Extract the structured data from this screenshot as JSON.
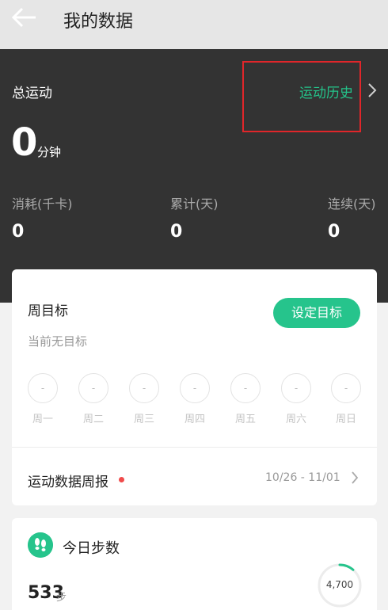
{
  "header": {
    "title": "我的数据"
  },
  "summary": {
    "total_label": "总运动",
    "history_link": "运动历史",
    "total_value": "0",
    "total_unit": "分钟",
    "stats": [
      {
        "label": "消耗(千卡)",
        "value": "0"
      },
      {
        "label": "累计(天)",
        "value": "0"
      },
      {
        "label": "连续(天)",
        "value": "0"
      }
    ]
  },
  "goal": {
    "title": "周目标",
    "subtitle": "当前无目标",
    "button": "设定目标",
    "days": [
      {
        "mark": "-",
        "label": "周一"
      },
      {
        "mark": "-",
        "label": "周二"
      },
      {
        "mark": "-",
        "label": "周三"
      },
      {
        "mark": "-",
        "label": "周四"
      },
      {
        "mark": "-",
        "label": "周五"
      },
      {
        "mark": "-",
        "label": "周六"
      },
      {
        "mark": "-",
        "label": "周日"
      }
    ]
  },
  "report": {
    "label": "运动数据周报",
    "range": "10/26 - 11/01"
  },
  "steps": {
    "title": "今日步数",
    "value": "533",
    "unit": "步",
    "goal": "4,700",
    "progress": 0.113
  },
  "colors": {
    "accent": "#26c48c",
    "dark_bg": "#333333",
    "highlight": "#e0262a"
  }
}
